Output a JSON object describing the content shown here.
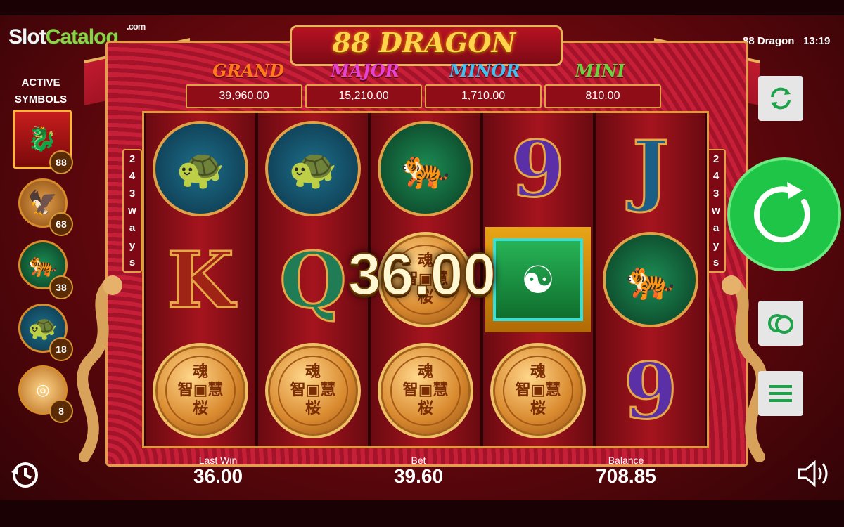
{
  "watermark": {
    "part1": "Slot",
    "part2": "Catalog",
    "suffix": ".com"
  },
  "status": {
    "title": "88 Dragon",
    "time": "13:19"
  },
  "game": {
    "title": "88 DRAGON"
  },
  "jackpots": [
    {
      "label": "GRAND",
      "value": "39,960.00",
      "color": "#ff7a1a"
    },
    {
      "label": "MAJOR",
      "value": "15,210.00",
      "color": "#e443d6"
    },
    {
      "label": "MINOR",
      "value": "1,710.00",
      "color": "#3ec0f0"
    },
    {
      "label": "MINI",
      "value": "810.00",
      "color": "#6ad13f"
    }
  ],
  "ways": {
    "number": [
      "2",
      "4",
      "3"
    ],
    "word": [
      "w",
      "a",
      "y",
      "s"
    ]
  },
  "active_symbols": {
    "title_line1": "ACTIVE",
    "title_line2": "SYMBOLS",
    "items": [
      {
        "icon": "dragon-icon",
        "badge": "88"
      },
      {
        "icon": "phoenix-icon",
        "badge": "68"
      },
      {
        "icon": "tiger-icon",
        "badge": "38"
      },
      {
        "icon": "turtle-icon",
        "badge": "18"
      },
      {
        "icon": "coin-icon",
        "badge": "8"
      }
    ]
  },
  "reels": [
    [
      "turtle",
      "K",
      "coin"
    ],
    [
      "turtle",
      "Q",
      "coin"
    ],
    [
      "tiger",
      "coin",
      "coin"
    ],
    [
      "9",
      "treasure-box",
      "coin"
    ],
    [
      "J",
      "tiger",
      "9"
    ]
  ],
  "coin_text": {
    "top": "魂",
    "left": "智",
    "right": "慧",
    "bottom": "桜"
  },
  "big_win": "36.00",
  "bottom": {
    "last_win_label": "Last Win",
    "last_win_value": "36.00",
    "bet_label": "Bet",
    "bet_value": "39.60",
    "balance_label": "Balance",
    "balance_value": "708.85"
  },
  "colors": {
    "spin_button": "#1ec547",
    "frame_gold": "#e0a046"
  }
}
